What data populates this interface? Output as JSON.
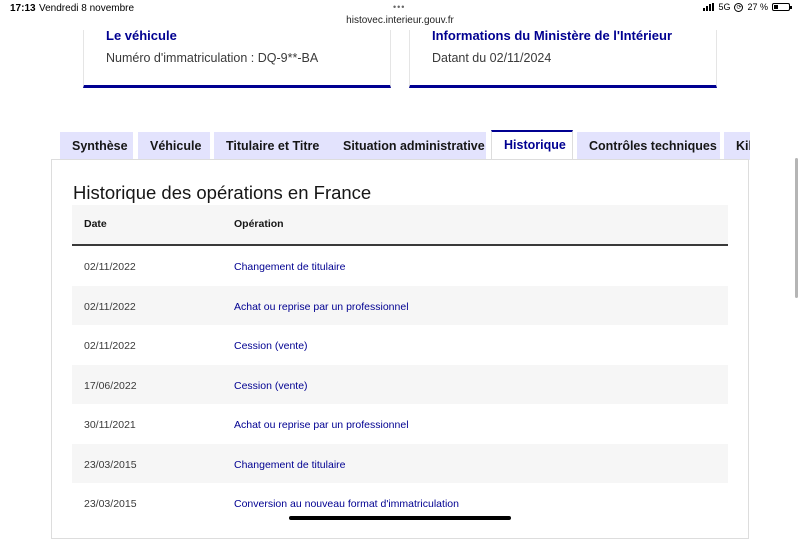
{
  "status_bar": {
    "time": "17:13",
    "date": "Vendredi 8 novembre",
    "url": "histovec.interieur.gouv.fr",
    "network": "5G",
    "battery": "27 %",
    "battery_level": 0.27
  },
  "cards": {
    "vehicule": {
      "title": "Le véhicule",
      "value": "Numéro d'immatriculation : DQ-9**-BA"
    },
    "ministere": {
      "title": "Informations du Ministère de l'Intérieur",
      "value": "Datant du 02/11/2024"
    }
  },
  "tabs": [
    {
      "label": "Synthèse",
      "active": false
    },
    {
      "label": "Véhicule",
      "active": false
    },
    {
      "label": "Titulaire et Titre",
      "active": false
    },
    {
      "label": "Situation administrative",
      "active": false
    },
    {
      "label": "Historique",
      "active": true
    },
    {
      "label": "Contrôles techniques",
      "active": false
    },
    {
      "label": "Kilométrage",
      "active": false
    }
  ],
  "historique": {
    "title": "Historique des opérations en France",
    "columns": [
      "Date",
      "Opération"
    ],
    "rows": [
      {
        "date": "02/11/2022",
        "operation": "Changement de titulaire"
      },
      {
        "date": "02/11/2022",
        "operation": "Achat ou reprise par un professionnel"
      },
      {
        "date": "02/11/2022",
        "operation": "Cession (vente)"
      },
      {
        "date": "17/06/2022",
        "operation": "Cession (vente)"
      },
      {
        "date": "30/11/2021",
        "operation": "Achat ou reprise par un professionnel"
      },
      {
        "date": "23/03/2015",
        "operation": "Changement de titulaire"
      },
      {
        "date": "23/03/2015",
        "operation": "Conversion au nouveau format d'immatriculation"
      }
    ]
  },
  "colors": {
    "accent": "#000091",
    "tab_background": "#e3e3fd",
    "row_alt": "#f6f6f6"
  }
}
